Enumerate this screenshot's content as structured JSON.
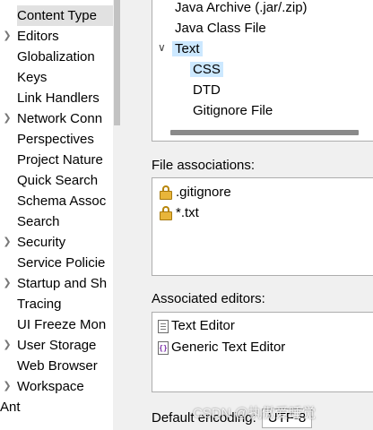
{
  "nav": {
    "items": [
      {
        "label": "",
        "expandable": false
      },
      {
        "label": "Content Type",
        "expandable": false,
        "selected": true
      },
      {
        "label": "Editors",
        "expandable": true
      },
      {
        "label": "Globalization",
        "expandable": false
      },
      {
        "label": "Keys",
        "expandable": false
      },
      {
        "label": "Link Handlers",
        "expandable": false
      },
      {
        "label": "Network Conn",
        "expandable": true
      },
      {
        "label": "Perspectives",
        "expandable": false
      },
      {
        "label": "Project Nature",
        "expandable": false
      },
      {
        "label": "Quick Search",
        "expandable": false
      },
      {
        "label": "Schema Assoc",
        "expandable": false
      },
      {
        "label": "Search",
        "expandable": false
      },
      {
        "label": "Security",
        "expandable": true
      },
      {
        "label": "Service Policie",
        "expandable": false
      },
      {
        "label": "Startup and Sh",
        "expandable": true
      },
      {
        "label": "Tracing",
        "expandable": false
      },
      {
        "label": "UI Freeze Mon",
        "expandable": false
      },
      {
        "label": "User Storage",
        "expandable": true
      },
      {
        "label": "Web Browser",
        "expandable": false
      },
      {
        "label": "Workspace",
        "expandable": true
      },
      {
        "label": "Ant",
        "expandable": false,
        "root": true
      }
    ]
  },
  "content_types": {
    "rows": [
      {
        "label": "Java Archive (.jar/.zip)",
        "level": 1
      },
      {
        "label": "Java Class File",
        "level": 1
      },
      {
        "label": "Text",
        "level": 1,
        "expanded": true,
        "selected": true
      },
      {
        "label": "CSS",
        "level": 2,
        "selected": true
      },
      {
        "label": "DTD",
        "level": 2
      },
      {
        "label": "Gitignore File",
        "level": 2
      }
    ]
  },
  "file_associations": {
    "label": "File associations:",
    "items": [
      {
        "label": ".gitignore",
        "icon": "lock-icon"
      },
      {
        "label": "*.txt",
        "icon": "lock-icon"
      }
    ]
  },
  "associated_editors": {
    "label": "Associated editors:",
    "items": [
      {
        "label": "Text Editor",
        "icon": "text-editor-icon"
      },
      {
        "label": "Generic Text Editor",
        "icon": "generic-editor-icon"
      }
    ]
  },
  "encoding": {
    "label": "Default encoding:",
    "value": "UTF-8"
  },
  "watermark": "CSDN @执傲爱睡觉",
  "colors": {
    "selection": "#cce8ff",
    "nav_selection": "#e1e1e1",
    "background": "#f0f0f0"
  }
}
